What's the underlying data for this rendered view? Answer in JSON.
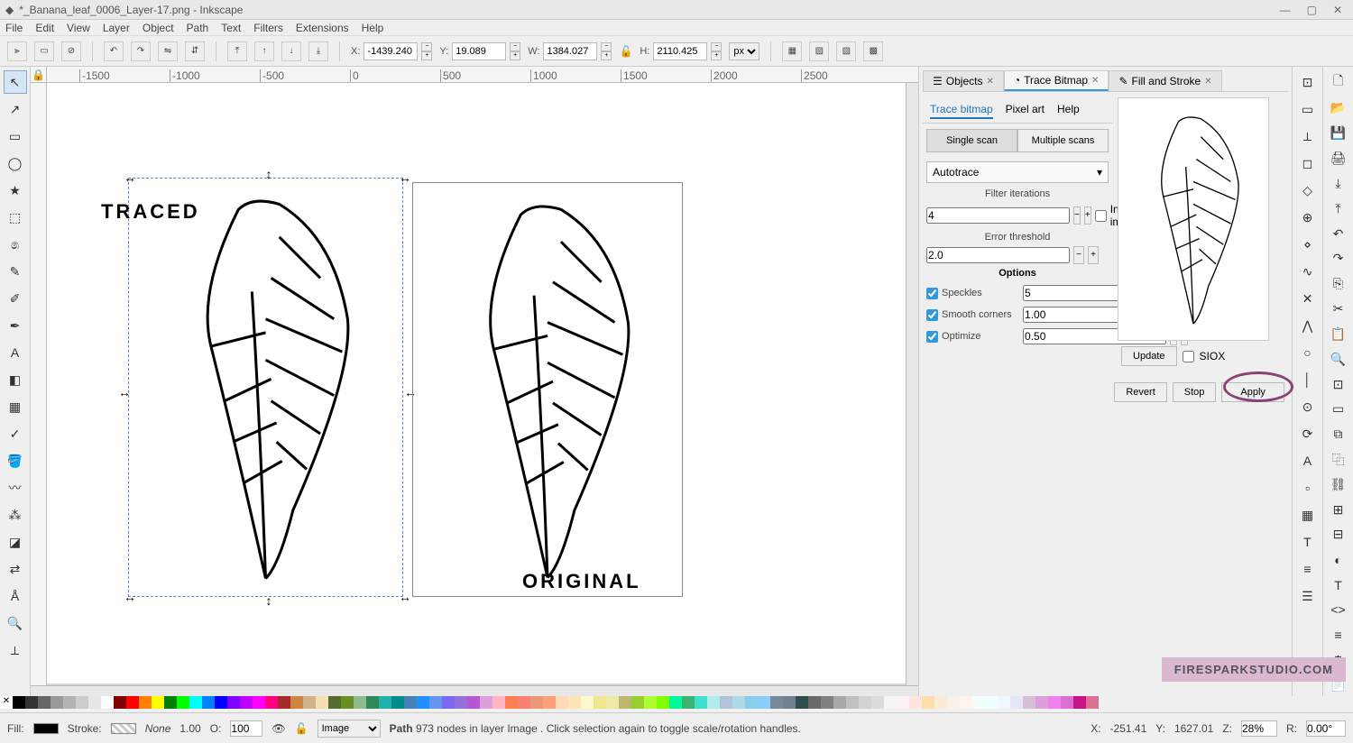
{
  "title": "*_Banana_leaf_0006_Layer-17.png - Inkscape",
  "menus": [
    "File",
    "Edit",
    "View",
    "Layer",
    "Object",
    "Path",
    "Text",
    "Filters",
    "Extensions",
    "Help"
  ],
  "toolbar": {
    "x_label": "X:",
    "x": "-1439.240",
    "y_label": "Y:",
    "y": "19.089",
    "w_label": "W:",
    "w": "1384.027",
    "h_label": "H:",
    "h": "2110.425",
    "unit": "px"
  },
  "ruler_ticks_h": [
    "-1500",
    "-1000",
    "-500",
    "0",
    "500",
    "1000",
    "1500",
    "2000",
    "2500"
  ],
  "canvas": {
    "traced_label": "TRACED",
    "original_label": "ORIGINAL"
  },
  "dock_tabs": [
    {
      "label": "Objects"
    },
    {
      "label": "Trace Bitmap"
    },
    {
      "label": "Fill and Stroke"
    }
  ],
  "trace": {
    "subtabs": [
      "Trace bitmap",
      "Pixel art",
      "Help"
    ],
    "scan_single": "Single scan",
    "scan_multi": "Multiple scans",
    "method": "Autotrace",
    "filter_iterations_label": "Filter iterations",
    "filter_iterations": "4",
    "error_threshold_label": "Error threshold",
    "error_threshold": "2.0",
    "invert_label": "Invert image",
    "options_label": "Options",
    "speckles_label": "Speckles",
    "speckles": "5",
    "smooth_label": "Smooth corners",
    "smooth": "1.00",
    "optimize_label": "Optimize",
    "optimize": "0.50",
    "update": "Update",
    "siox": "SIOX",
    "revert": "Revert",
    "stop": "Stop",
    "apply": "Apply"
  },
  "statusbar": {
    "fill_label": "Fill:",
    "stroke_label": "Stroke:",
    "stroke_none": "None",
    "stroke_w": "1.00",
    "opacity_label": "O:",
    "opacity": "100",
    "layer": "Image",
    "hint_prefix": "Path ",
    "hint_nodes": "973 nodes in layer Image",
    "hint_rest": ". Click selection again to toggle scale/rotation handles.",
    "cursor_x_label": "X:",
    "cursor_x": "-251.41",
    "cursor_y_label": "Y:",
    "cursor_y": "1627.01",
    "zoom_label": "Z:",
    "zoom": "28%",
    "rot_label": "R:",
    "rot": "0.00°"
  },
  "watermark": "FIRESPARKSTUDIO.COM",
  "palette_colors": [
    "#000",
    "#333",
    "#666",
    "#999",
    "#b3b3b3",
    "#ccc",
    "#e6e6e6",
    "#fff",
    "#800000",
    "#f00",
    "#ff8000",
    "#ff0",
    "#008000",
    "#0f0",
    "#00ffff",
    "#0080ff",
    "#00f",
    "#8000ff",
    "#bf00ff",
    "#ff00ff",
    "#ff0080",
    "#a52a2a",
    "#cd853f",
    "#d2b48c",
    "#f5deb3",
    "#556b2f",
    "#6b8e23",
    "#8fbc8f",
    "#2e8b57",
    "#20b2aa",
    "#008b8b",
    "#4682b4",
    "#1e90ff",
    "#6495ed",
    "#7b68ee",
    "#9370db",
    "#ba55d3",
    "#dda0dd",
    "#ffb6c1",
    "#ff7f50",
    "#fa8072",
    "#e9967a",
    "#ffa07a",
    "#ffdab9",
    "#ffe4b5",
    "#fffacd",
    "#f0e68c",
    "#eee8aa",
    "#bdb76b",
    "#9acd32",
    "#adff2f",
    "#7fff00",
    "#00fa9a",
    "#3cb371",
    "#40e0d0",
    "#afeeee",
    "#b0c4de",
    "#add8e6",
    "#87ceeb",
    "#87cefa",
    "#778899",
    "#708090",
    "#2f4f4f",
    "#696969",
    "#808080",
    "#a9a9a9",
    "#c0c0c0",
    "#d3d3d3",
    "#dcdcdc",
    "#f5f5f5",
    "#fff0f5",
    "#ffe4e1",
    "#ffdead",
    "#faebd7",
    "#faf0e6",
    "#fff5ee",
    "#f5fffa",
    "#f0ffff",
    "#f0f8ff",
    "#e6e6fa",
    "#d8bfd8",
    "#dda0dd",
    "#ee82ee",
    "#da70d6",
    "#c71585",
    "#db7093"
  ]
}
